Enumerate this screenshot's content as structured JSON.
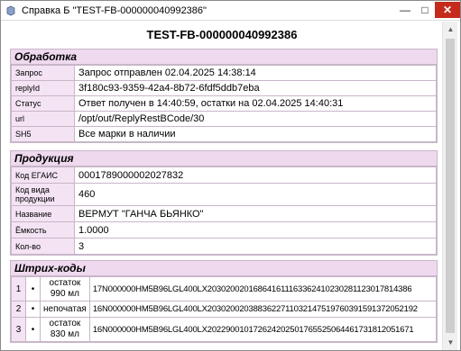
{
  "window": {
    "title": "Справка Б \"TEST-FB-000000040992386\""
  },
  "doc_title": "TEST-FB-000000040992386",
  "processing": {
    "heading": "Обработка",
    "rows": [
      {
        "key": "Запрос",
        "value": "Запрос отправлен 02.04.2025 14:38:14"
      },
      {
        "key": "replyId",
        "value": "3f180c93-9359-42a4-8b72-6fdf5ddb7eba"
      },
      {
        "key": "Статус",
        "value": "Ответ получен в 14:40:59, остатки на 02.04.2025 14:40:31"
      },
      {
        "key": "url",
        "value": "/opt/out/ReplyRestBCode/30"
      },
      {
        "key": "SH5",
        "value": "Все марки в наличии"
      }
    ]
  },
  "product": {
    "heading": "Продукция",
    "rows": [
      {
        "key": "Код ЕГАИС",
        "value": "0001789000002027832"
      },
      {
        "key": "Код вида продукции",
        "value": "460"
      },
      {
        "key": "Название",
        "value": "ВЕРМУТ \"ГАНЧА БЬЯНКО\""
      },
      {
        "key": "Ёмкость",
        "value": "1.0000"
      },
      {
        "key": "Кол-во",
        "value": "3"
      }
    ]
  },
  "barcodes": {
    "heading": "Штрих-коды",
    "rows": [
      {
        "n": "1",
        "dot": "•",
        "status": "остаток 990 мл",
        "code": "17N000000HM5B96LGL400LX2030200201686416111633624102302811230178143​86"
      },
      {
        "n": "2",
        "dot": "•",
        "status": "непочатая",
        "code": "16N000000HM5B96LGL400LX2030200203883622711032147519760391591372052192"
      },
      {
        "n": "3",
        "dot": "•",
        "status": "остаток 830 мл",
        "code": "16N000000HM5B96LGL400LX2022900101726242025017655250644617318120516​71"
      }
    ]
  }
}
